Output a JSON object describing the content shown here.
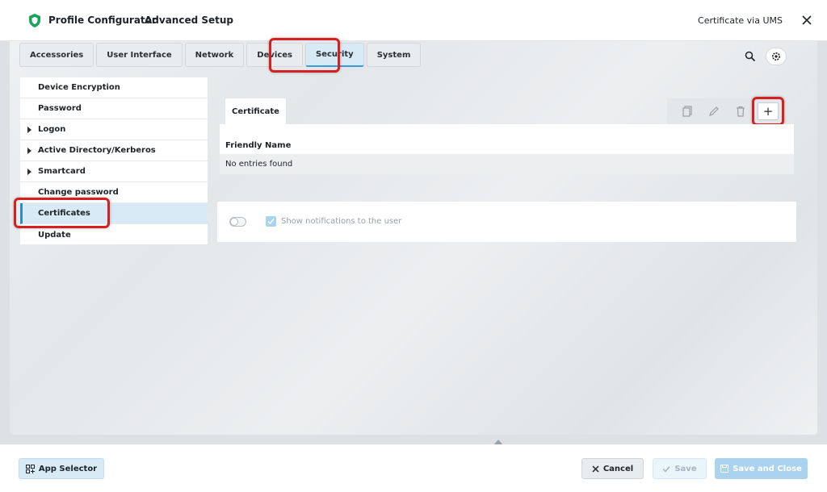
{
  "header": {
    "app_title": "Profile Configurator",
    "subtitle": "Advanced Setup",
    "profile_name": "Certificate via UMS",
    "accent_color": "#1aa35b"
  },
  "tabs": [
    {
      "label": "Accessories"
    },
    {
      "label": "User Interface"
    },
    {
      "label": "Network"
    },
    {
      "label": "Devices"
    },
    {
      "label": "Security",
      "active": true
    },
    {
      "label": "System"
    }
  ],
  "sidebar": {
    "items": [
      {
        "label": "Device Encryption",
        "expandable": false
      },
      {
        "label": "Password",
        "expandable": false
      },
      {
        "label": "Logon",
        "expandable": true
      },
      {
        "label": "Active Directory/Kerberos",
        "expandable": true
      },
      {
        "label": "Smartcard",
        "expandable": true
      },
      {
        "label": "Change password",
        "expandable": false
      },
      {
        "label": "Certificates",
        "active": true
      },
      {
        "label": "Update",
        "expandable": false
      }
    ]
  },
  "content": {
    "tab_label": "Certificate",
    "column_header": "Friendly Name",
    "empty_text": "No entries found",
    "add_label": "+",
    "notification_label": "Show notifications to the user"
  },
  "footer": {
    "app_selector": "App Selector",
    "cancel": "Cancel",
    "save": "Save",
    "save_and_close": "Save and Close"
  },
  "colors": {
    "highlight": "#d61f1f",
    "active_bg": "#d7eaf6",
    "active_border": "#2e8bc9"
  }
}
